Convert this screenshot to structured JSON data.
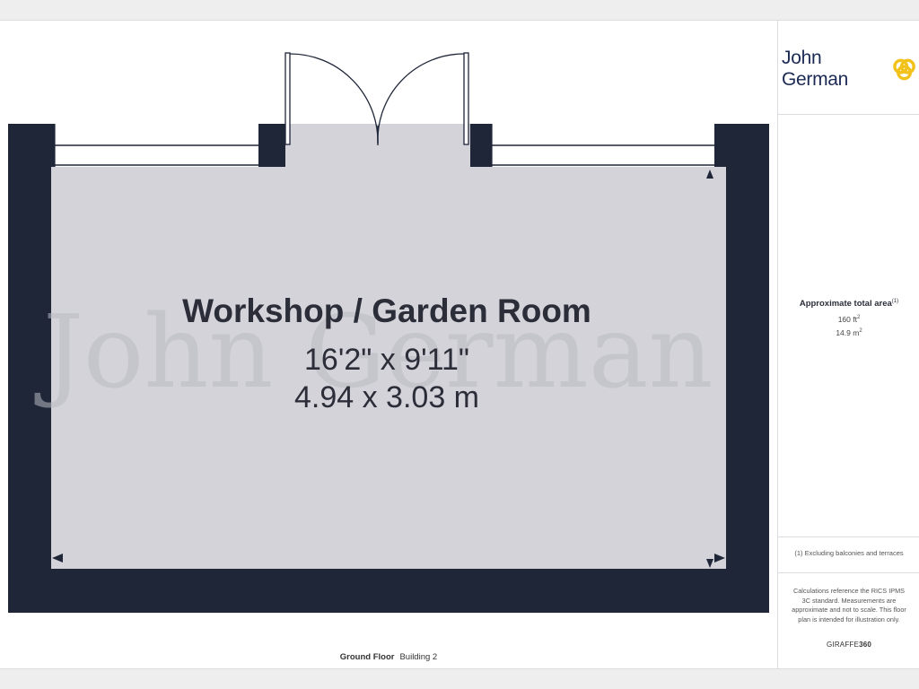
{
  "brand": {
    "name": "John German",
    "logo_color": "#1b2a55",
    "logo_mark_color": "#f2c21b"
  },
  "room": {
    "name": "Workshop / Garden Room",
    "dim_imperial": "16'2\" x 9'11\"",
    "dim_metric": "4.94 x 3.03 m"
  },
  "area": {
    "title": "Approximate total area",
    "title_note": "(1)",
    "sqft": "160 ft",
    "sqm": "14.9 m",
    "unit_power": "2"
  },
  "note": "(1) Excluding balconies and terraces",
  "calc_text": "Calculations reference the RICS IPMS 3C standard. Measurements are approximate and not to scale. This floor plan is intended for illustration only.",
  "giraffe": {
    "prefix": "GIRAFFE",
    "suffix": "360"
  },
  "floor": {
    "label": "Ground Floor",
    "building": "Building 2"
  },
  "colors": {
    "wall": "#1e2638",
    "floor": "#d4d3d9",
    "window": "#ffffff",
    "text": "#2b2d39"
  }
}
